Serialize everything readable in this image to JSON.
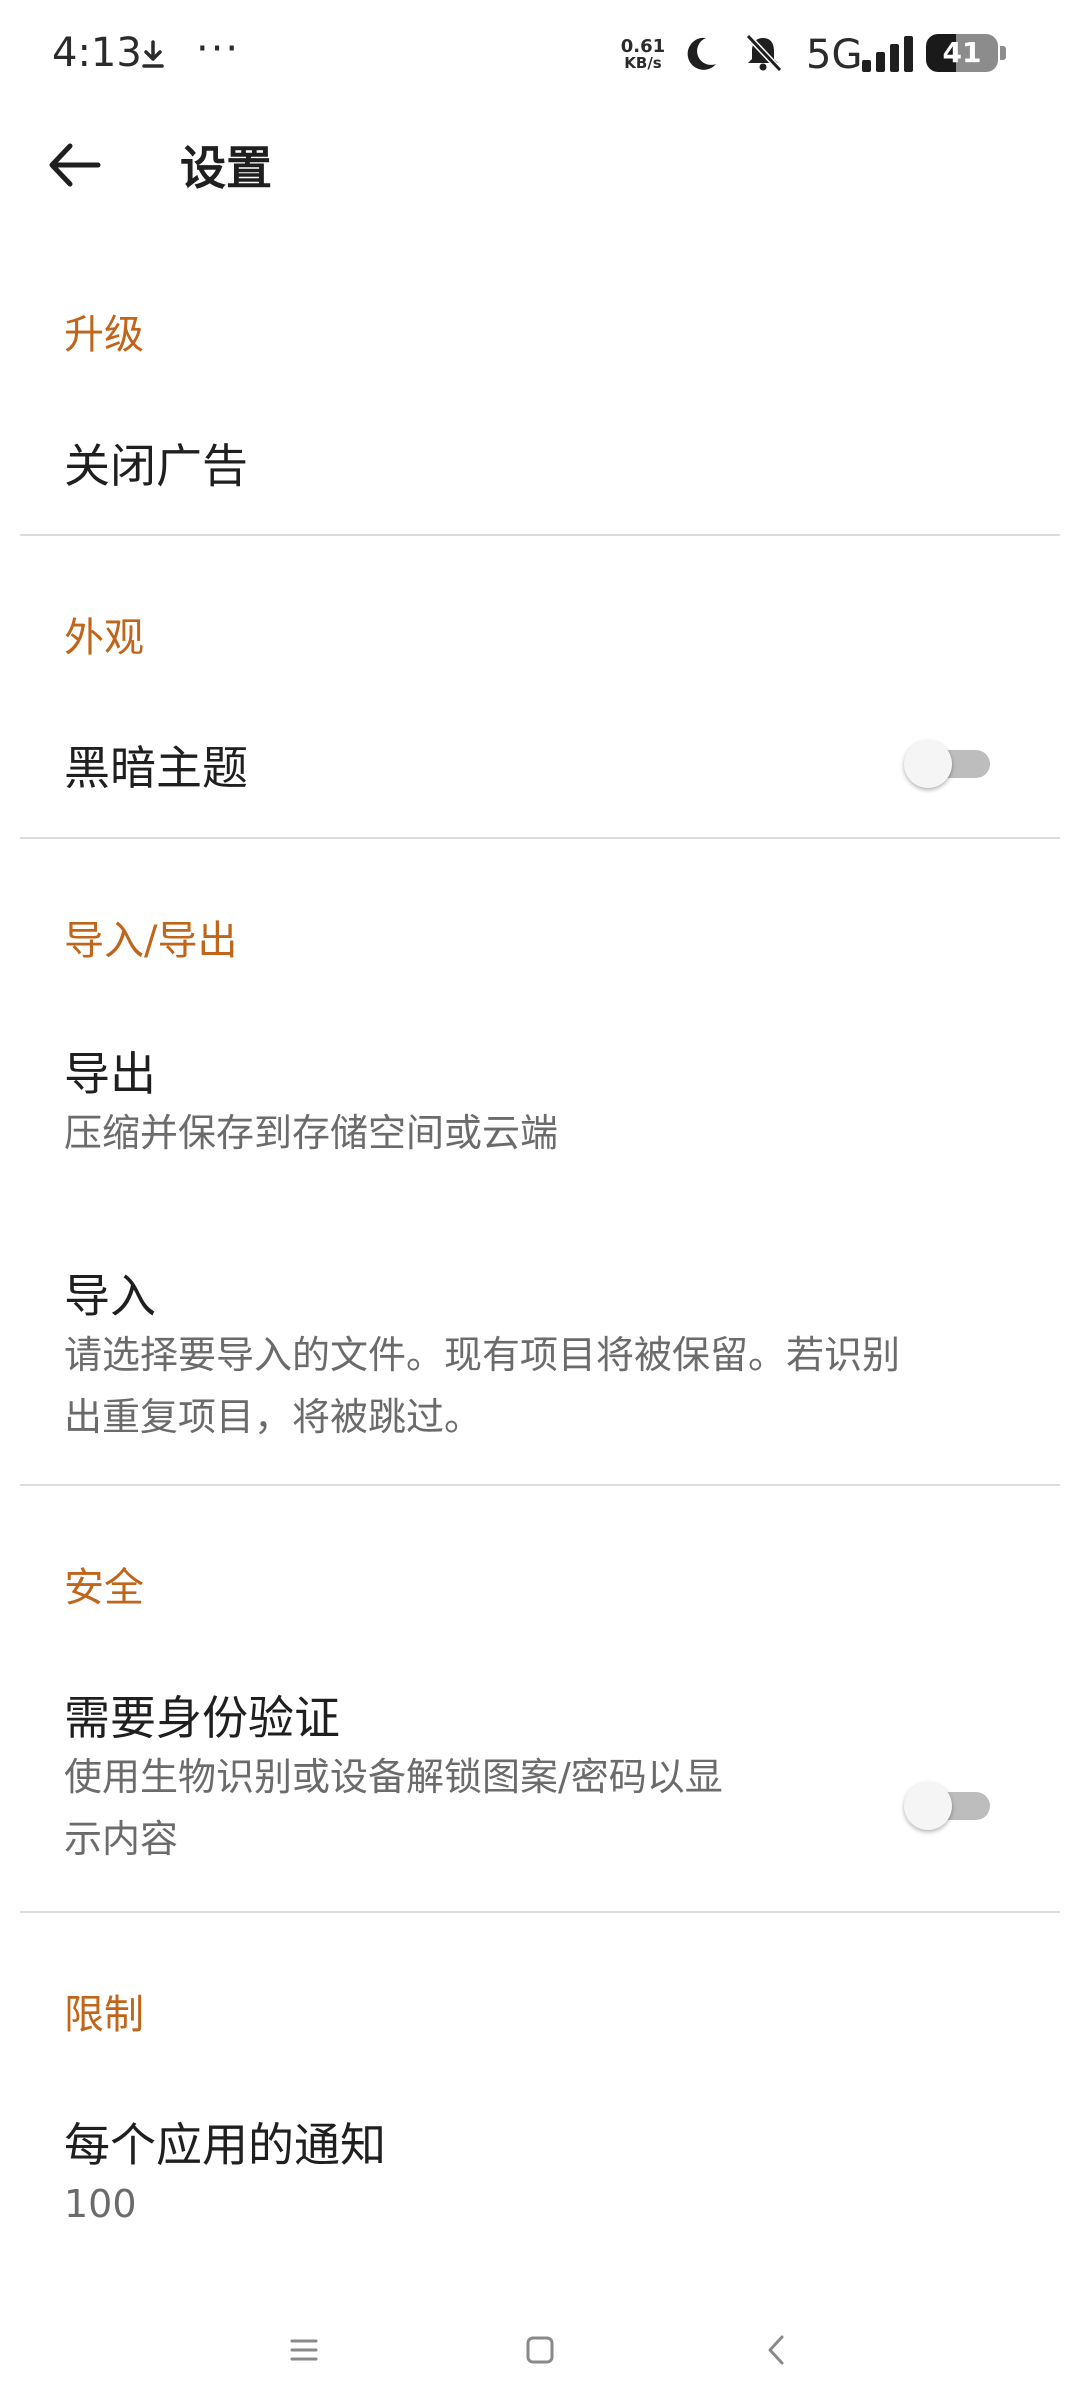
{
  "status_bar": {
    "time": "4:13",
    "more": "···",
    "speed_value": "0.61",
    "speed_unit": "KB/s",
    "network": "5G",
    "battery": "41",
    "battery_fraction": 0.41
  },
  "app_bar": {
    "title": "设置"
  },
  "sections": {
    "upgrade": {
      "header": "升级",
      "remove_ads": "关闭广告"
    },
    "appearance": {
      "header": "外观",
      "dark_theme": "黑暗主题",
      "dark_theme_on": false
    },
    "import_export": {
      "header": "导入/导出",
      "export_title": "导出",
      "export_sub": "压缩并保存到存储空间或云端",
      "import_title": "导入",
      "import_sub_line1": "请选择要导入的文件。现有项目将被保留。若识别",
      "import_sub_line2": "出重复项目，将被跳过。"
    },
    "security": {
      "header": "安全",
      "auth_title": "需要身份验证",
      "auth_sub_line1": "使用生物识别或设备解锁图案/密码以显",
      "auth_sub_line2": "示内容",
      "auth_on": false
    },
    "limits": {
      "header": "限制",
      "per_app_title": "每个应用的通知",
      "per_app_value": "100"
    }
  },
  "colors": {
    "accent": "#c0651a",
    "text_primary": "#1f1f1f",
    "text_secondary": "#6b6b6b",
    "divider": "#dcdcdc"
  },
  "icons": {
    "back": "arrow-left-icon",
    "download": "download-icon",
    "moon": "moon-icon",
    "bell_off": "bell-off-icon",
    "signal": "signal-icon",
    "battery": "battery-icon",
    "nav_menu": "menu-icon",
    "nav_home": "home-square-icon",
    "nav_back": "chevron-left-icon"
  }
}
